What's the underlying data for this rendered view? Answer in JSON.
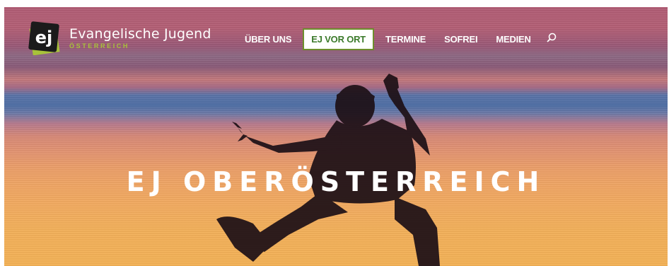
{
  "brand": {
    "name": "Evangelische Jugend",
    "sub": "ÖSTERREICH",
    "logo_letters": "ej",
    "accent_color": "#a8c23a"
  },
  "nav": {
    "items": [
      {
        "label": "ÜBER UNS",
        "active": false
      },
      {
        "label": "EJ VOR ORT",
        "active": true
      },
      {
        "label": "TERMINE",
        "active": false
      },
      {
        "label": "SOFREI",
        "active": false
      },
      {
        "label": "MEDIEN",
        "active": false
      }
    ],
    "search_icon": "search-icon",
    "active_color": "#3b7a2a"
  },
  "hero": {
    "title": "EJ OBERÖSTERREICH"
  }
}
